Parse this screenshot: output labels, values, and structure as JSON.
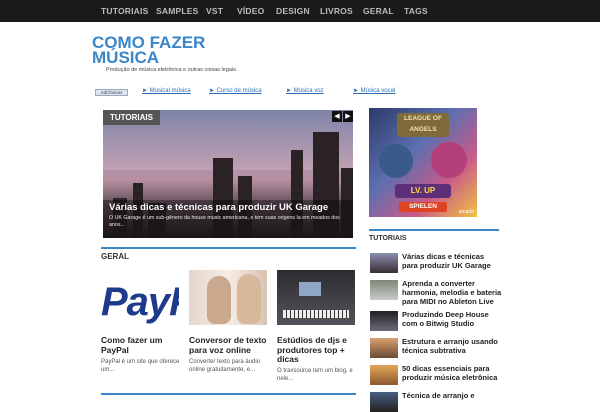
{
  "nav": {
    "items": [
      "TUTORIAIS",
      "SAMPLES",
      "VST",
      "VÍDEO",
      "DESIGN",
      "LIVROS",
      "GERAL",
      "TAGS"
    ]
  },
  "site": {
    "title": "COMO FAZER MÚSICA",
    "tagline": "Produção de música eletrônica e outras coisas legais."
  },
  "adbar": {
    "adchoices": "AdChoices",
    "links": [
      "► Musical música",
      "► Curso de música",
      "► Música voz",
      "► Música vocal"
    ]
  },
  "featured": {
    "category": "TUTORIAIS",
    "title": "Várias dicas e técnicas para produzir UK Garage",
    "description": "O UK Garage é um sub-gênero da house music americana, e tem suas origens la em meados dos anos...",
    "prev_label": "◀",
    "next_label": "▶"
  },
  "geral": {
    "heading": "GERAL",
    "cards": [
      {
        "title": "Como fazer um PayPal",
        "desc": "PayPal é um site que oferece um...",
        "image_text": "PayP"
      },
      {
        "title": "Conversor de texto para voz online",
        "desc": "Converter texto para áudio online gratuitamente, e..."
      },
      {
        "title": "Estúdios de djs e produtores top + dicas",
        "desc": "O traxsource tem um blog, e nele..."
      }
    ]
  },
  "ad": {
    "logo": "LEAGUE OF ANGELS",
    "level": "LV. UP",
    "cta": "SPIELEN",
    "brand": "arcade"
  },
  "sidebar": {
    "heading": "TUTORIAIS",
    "items": [
      "Várias dicas e técnicas para produzir UK Garage",
      "Aprenda a converter harmonia, melodia e bateria para MIDI no Ableton Live",
      "Produzindo Deep House com o Bitwig Studio",
      "Estrutura e arranjo usando técnica subtrativa",
      "50 dicas essenciais para produzir música eletrônica",
      "Técnica de arranjo e"
    ]
  },
  "colors": {
    "accent": "#3a86c8",
    "nav_bg": "#1a1a1a"
  }
}
